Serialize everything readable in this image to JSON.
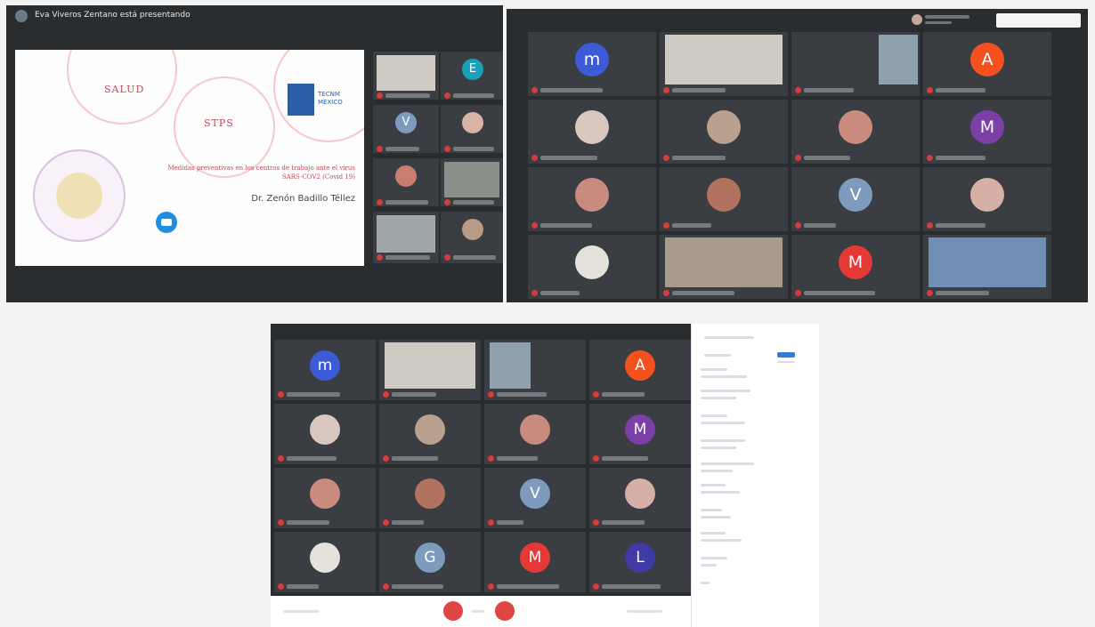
{
  "screenshot1": {
    "presenter_banner": "Eva Viveros Zentano está presentando",
    "slide": {
      "word1": "SALUD",
      "word2": "STPS",
      "logo_text": "TECNM MEXICO",
      "title": "Medidas preventivas en los centros de trabajo ante el virus SARS-COV2 (Covid 19)",
      "presenter": "Dr. Zenón Badillo Téllez"
    }
  },
  "icons": [
    "mic-muted-icon",
    "zoom-camera-icon",
    "end-call-icon"
  ],
  "colors": {
    "tile_bg": "#3a3d41",
    "muted_mic": "#d63a3a",
    "accent_red": "#c0485a",
    "avatar_blue": "#3d5bd6",
    "avatar_orange": "#f4511e",
    "avatar_purple": "#7b3fa6",
    "avatar_gray": "#7e9bbd",
    "avatar_red": "#e53935",
    "avatar_indigo": "#3f3aa6"
  },
  "avatars": {
    "s1_e": "E",
    "s1_v": "V",
    "s2_m1": "m",
    "s2_a": "A",
    "s2_m2": "M",
    "s2_v": "V",
    "s2_m3": "M",
    "s3_m1": "m",
    "s3_a": "A",
    "s3_m2": "M",
    "s3_v": "V",
    "s3_g": "G",
    "s3_m3": "M",
    "s3_l": "L"
  }
}
